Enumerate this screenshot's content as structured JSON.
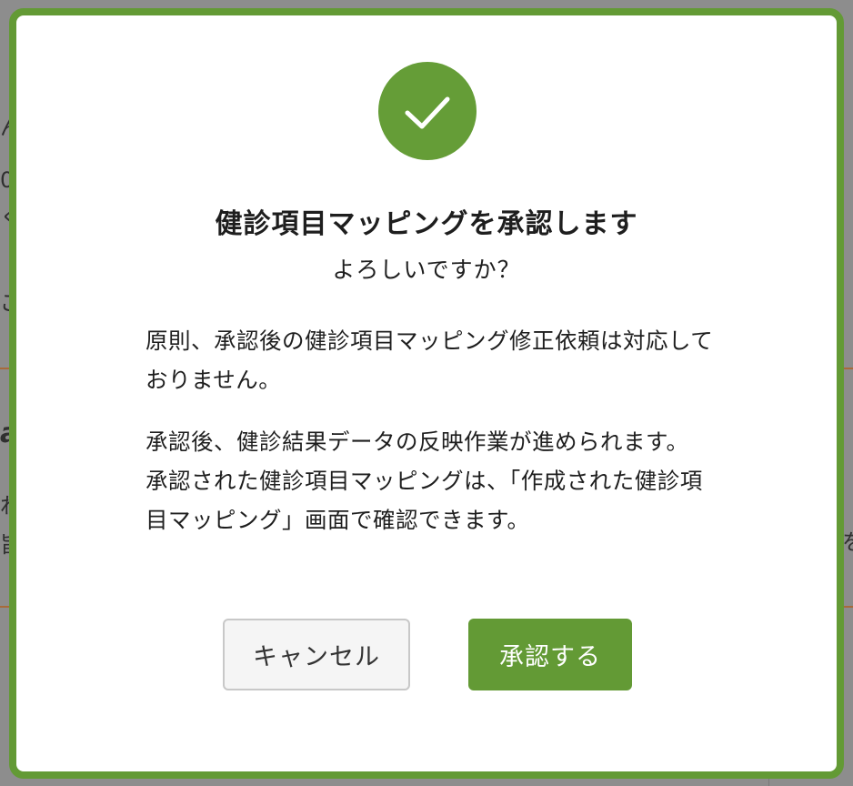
{
  "background": {
    "fragments": [
      "ん",
      "0",
      "く",
      "ご",
      "a",
      "れ",
      "旨",
      "を"
    ]
  },
  "dialog": {
    "title": "健診項目マッピングを承認します",
    "subtitle": "よろしいですか？",
    "paragraph1": "原則、承認後の健診項目マッピング修正依頼は対応しておりません。",
    "paragraph2_line1": "承認後、健診結果データの反映作業が進められます。",
    "paragraph2_line2": "承認された健診項目マッピングは、「作成された健診項目マッピング」画面で確認できます。",
    "icon": "check-icon",
    "cancel_label": "キャンセル",
    "approve_label": "承認する"
  },
  "colors": {
    "accent": "#639a35",
    "overlay": "#8d8d8d",
    "cancel_bg": "#f5f5f5",
    "text": "#1e1e1e"
  }
}
